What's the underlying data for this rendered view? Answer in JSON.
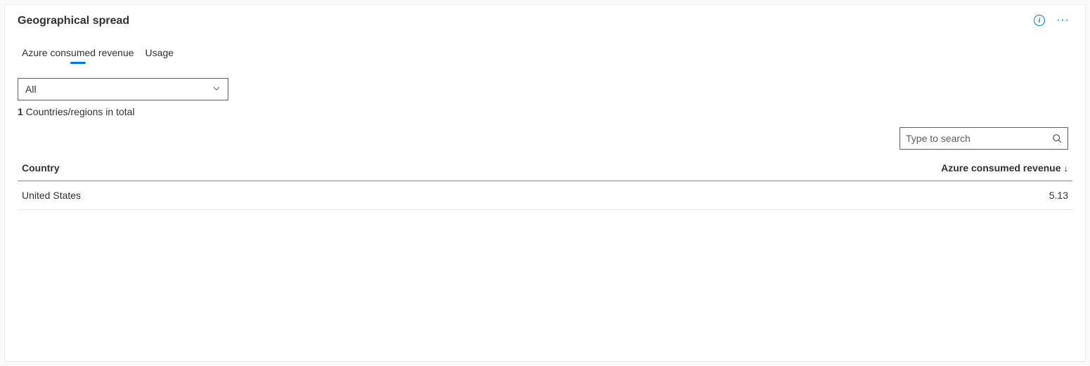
{
  "panel": {
    "title": "Geographical spread"
  },
  "tabs": {
    "items": [
      {
        "label": "Azure consumed revenue",
        "active": true
      },
      {
        "label": "Usage",
        "active": false
      }
    ]
  },
  "filter": {
    "selected": "All",
    "count": "1",
    "count_suffix": " Countries/regions in total"
  },
  "search": {
    "placeholder": "Type to search",
    "value": ""
  },
  "table": {
    "columns": {
      "country": "Country",
      "revenue": "Azure consumed revenue"
    },
    "rows": [
      {
        "country": "United States",
        "revenue": "5.13"
      }
    ]
  }
}
